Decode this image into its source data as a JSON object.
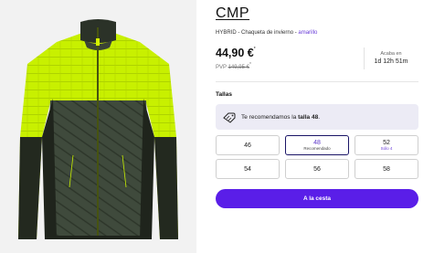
{
  "product": {
    "brand": "CMP",
    "name": "HYBRID - Chaqueta de invierno - ",
    "color": "amarillo",
    "price": "44,90 €",
    "price_marker": "*",
    "rrp_label": "PVP ",
    "rrp_value": "149,95 €",
    "rrp_marker": "*"
  },
  "countdown": {
    "label": "Acaba en",
    "time": "1d 12h 51m"
  },
  "sizes": {
    "title": "Tallas",
    "recommendation_prefix": "Te recomendamos la ",
    "recommendation_size": "talla 48",
    "recommendation_suffix": ".",
    "options": [
      {
        "size": "46",
        "note": ""
      },
      {
        "size": "48",
        "note": "Recomendado"
      },
      {
        "size": "52",
        "note": "Sólo 4"
      },
      {
        "size": "54",
        "note": ""
      },
      {
        "size": "56",
        "note": ""
      },
      {
        "size": "58",
        "note": ""
      }
    ]
  },
  "cart": {
    "label": "A la cesta"
  },
  "colors": {
    "accent": "#5a1ee8",
    "jacket_yellow": "#c8f000",
    "jacket_dark": "#3f4a3c",
    "background": "#f2f2f2"
  }
}
